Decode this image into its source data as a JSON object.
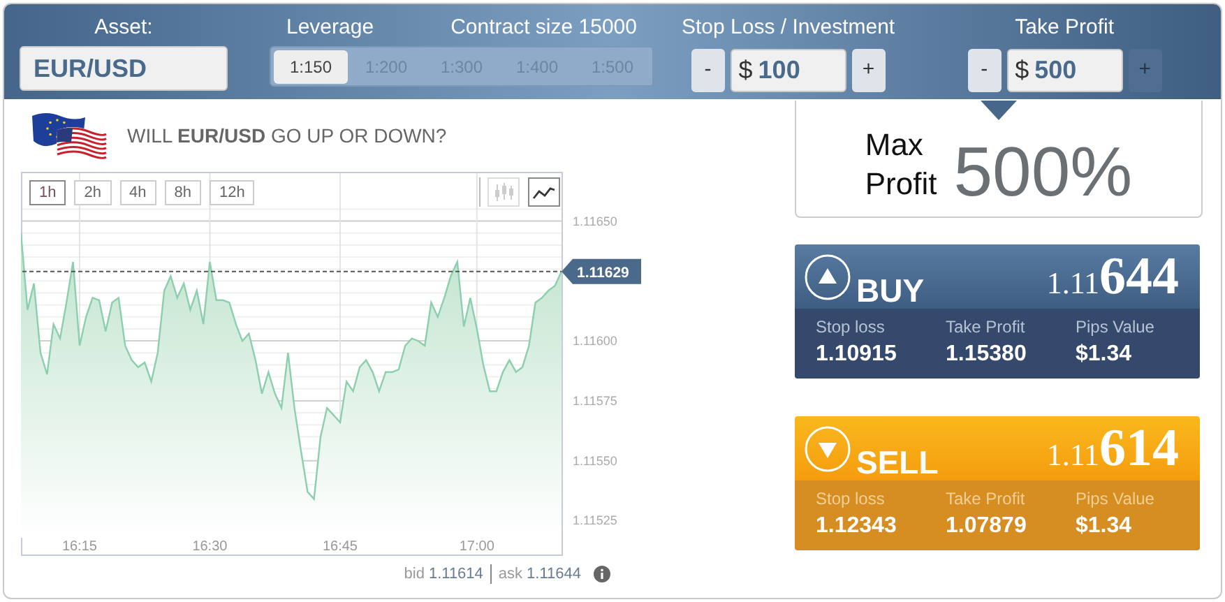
{
  "header": {
    "asset": {
      "label": "Asset:",
      "value": "EUR/USD"
    },
    "leverage": {
      "label": "Leverage",
      "options": [
        {
          "label": "1:150",
          "selected": true
        },
        {
          "label": "1:200",
          "selected": false
        },
        {
          "label": "1:300",
          "selected": false
        },
        {
          "label": "1:400",
          "selected": false
        },
        {
          "label": "1:500",
          "selected": false
        }
      ]
    },
    "contract_size": {
      "label": "Contract size",
      "value": "15000"
    },
    "steppers": [
      {
        "label": "Stop Loss / Investment",
        "minus": "-",
        "plus": "+",
        "currency": "$",
        "amount": "100",
        "plus_disabled": false
      },
      {
        "label": "Take Profit",
        "minus": "-",
        "plus": "+",
        "currency": "$",
        "amount": "500",
        "plus_disabled": true
      }
    ]
  },
  "question": "WILL **EUR/USD** GO UP OR DOWN?",
  "chart": {
    "periods": [
      {
        "label": "1h",
        "selected": true
      },
      {
        "label": "2h",
        "selected": false
      },
      {
        "label": "4h",
        "selected": false
      },
      {
        "label": "8h",
        "selected": false
      },
      {
        "label": "12h",
        "selected": false
      }
    ],
    "chart_types": [
      {
        "kind": "candles",
        "selected": false
      },
      {
        "kind": "line",
        "selected": true
      }
    ],
    "chart_data": {
      "type": "area",
      "ylim": [
        1.11519,
        1.11656
      ],
      "yticks": [
        {
          "value": 1.1165,
          "label": "1.11650"
        },
        {
          "value": 1.116,
          "label": "1.11600"
        },
        {
          "value": 1.11575,
          "label": "1.11575"
        },
        {
          "value": 1.1155,
          "label": "1.11550"
        },
        {
          "value": 1.11525,
          "label": "1.11525"
        }
      ],
      "categories": [
        null,
        null,
        null,
        null,
        null,
        null,
        null,
        null,
        null,
        "16:15",
        null,
        null,
        null,
        null,
        null,
        null,
        null,
        null,
        null,
        null,
        null,
        null,
        null,
        null,
        null,
        null,
        null,
        null,
        null,
        "16:30",
        null,
        null,
        null,
        null,
        null,
        null,
        null,
        null,
        null,
        null,
        null,
        null,
        null,
        null,
        null,
        null,
        null,
        null,
        null,
        "16:45",
        null,
        null,
        null,
        null,
        null,
        null,
        null,
        null,
        null,
        null,
        null,
        null,
        null,
        null,
        null,
        null,
        null,
        null,
        null,
        null,
        "17:00",
        null,
        null,
        null,
        null,
        null,
        null,
        null,
        null,
        null,
        null,
        null,
        null,
        null
      ],
      "series": [
        {
          "color": "#8ccfae",
          "values": [
            1.11645,
            1.11613,
            1.11624,
            1.11595,
            1.11586,
            1.11607,
            1.11601,
            1.11616,
            1.11633,
            1.11598,
            1.1161,
            1.11618,
            1.11617,
            1.11604,
            1.11616,
            1.11618,
            1.11598,
            1.11592,
            1.11589,
            1.11591,
            1.11583,
            1.11595,
            1.11621,
            1.11627,
            1.11618,
            1.11624,
            1.11613,
            1.11621,
            1.11607,
            1.11633,
            1.11617,
            1.11617,
            1.11616,
            1.11607,
            1.116,
            1.11603,
            1.11592,
            1.11578,
            1.11587,
            1.11578,
            1.11572,
            1.11595,
            1.11572,
            1.11554,
            1.11537,
            1.11534,
            1.1156,
            1.11572,
            1.11569,
            1.11566,
            1.11583,
            1.11579,
            1.11589,
            1.11592,
            1.11587,
            1.11579,
            1.11587,
            1.11587,
            1.11588,
            1.11598,
            1.11601,
            1.116,
            1.11598,
            1.11616,
            1.1161,
            1.11618,
            1.11627,
            1.11633,
            1.11606,
            1.11618,
            1.11605,
            1.1159,
            1.11579,
            1.11579,
            1.11587,
            1.11592,
            1.11587,
            1.11589,
            1.11598,
            1.11616,
            1.11618,
            1.11621,
            1.11623,
            1.11629
          ]
        }
      ],
      "grid": true,
      "annotations": [
        "1.11629"
      ]
    }
  },
  "quote": {
    "bid_label": "bid",
    "bid": "1.11614",
    "ask_label": "ask",
    "ask": "1.11644"
  },
  "max_profit": {
    "label": "Max Profit",
    "value": "500%"
  },
  "trades": [
    {
      "kind": "buy",
      "label": "BUY",
      "price_small": "1.11",
      "price_big": "644",
      "stats": [
        {
          "label": "Stop loss",
          "value": "1.10915"
        },
        {
          "label": "Take Profit",
          "value": "1.15380"
        },
        {
          "label": "Pips Value",
          "value": "$1.34"
        }
      ]
    },
    {
      "kind": "sell",
      "label": "SELL",
      "price_small": "1.11",
      "price_big": "614",
      "stats": [
        {
          "label": "Stop loss",
          "value": "1.12343"
        },
        {
          "label": "Take Profit",
          "value": "1.07879"
        },
        {
          "label": "Pips Value",
          "value": "$1.34"
        }
      ]
    }
  ]
}
